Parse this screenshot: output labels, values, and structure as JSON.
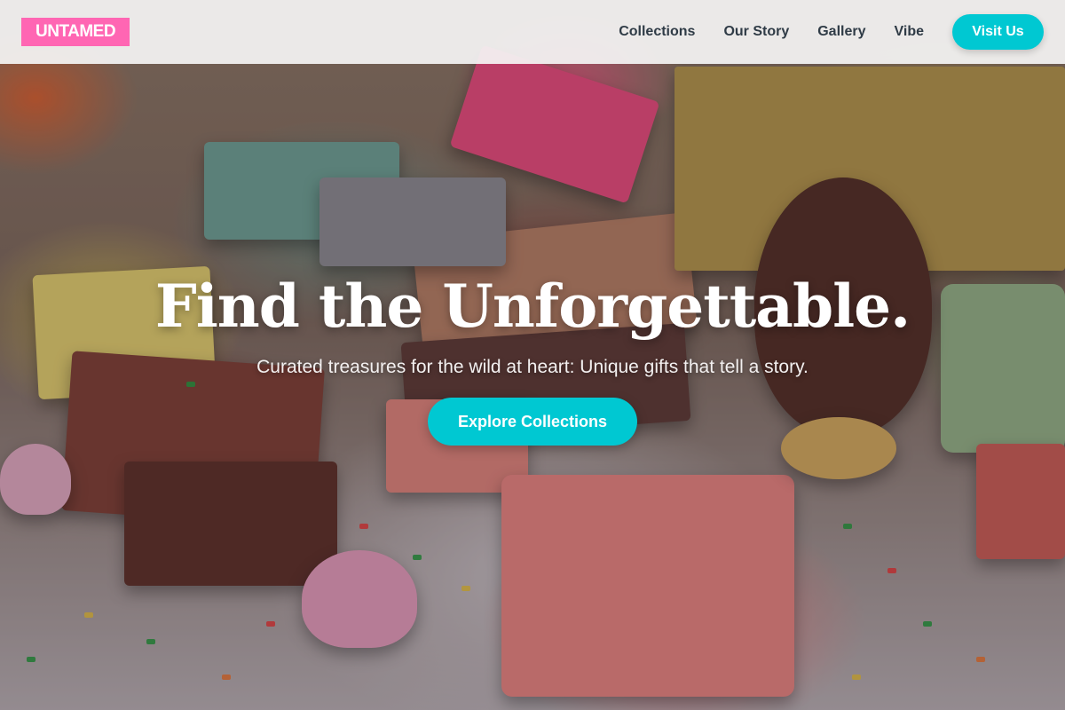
{
  "brand": {
    "logo_text": "UNTAMED",
    "logo_color": "#ff66b3"
  },
  "nav": {
    "links": [
      {
        "label": "Collections"
      },
      {
        "label": "Our Story"
      },
      {
        "label": "Gallery"
      },
      {
        "label": "Vibe"
      }
    ],
    "cta_label": "Visit Us"
  },
  "hero": {
    "title": "Find the Unforgettable.",
    "subtitle": "Curated treasures for the wild at heart: Unique gifts that tell a story.",
    "cta_label": "Explore Collections",
    "background": "photo of handmade soap bars, pine cone and colorful sprinkles"
  },
  "colors": {
    "accent": "#00c8d2",
    "header_bg": "#f5f5f5",
    "nav_text": "#2f3b46"
  }
}
